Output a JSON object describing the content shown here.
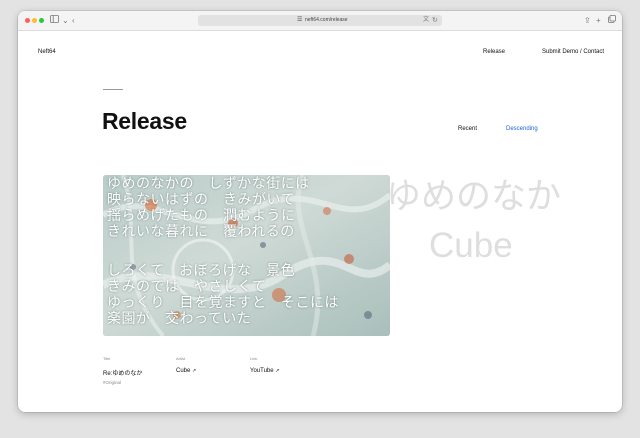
{
  "browser": {
    "url": "neft64.com/release",
    "icons": {
      "sidebar": "sidebar-icon",
      "back": "chevron-left-icon",
      "site": "site-settings-icon",
      "translate": "translate-icon",
      "reload": "reload-icon",
      "share": "share-icon",
      "new_tab": "plus-icon",
      "tabs": "tab-overview-icon"
    }
  },
  "site": {
    "logo": "Neft64",
    "nav": {
      "release": "Release",
      "submit": "Submit Demo / Contact"
    }
  },
  "page": {
    "title": "Release",
    "sort": {
      "recent": "Recent",
      "descending": "Descending",
      "active_color": "#1e63d6"
    }
  },
  "release": {
    "background_text": [
      "ゆめのなか",
      "Cube"
    ],
    "artwork_lines": [
      "ゆめのなかの　しずかな街には",
      "映らないはずの　きみがいて",
      "揺らめげたもの　潤むように",
      "きれいな暮れに　覆われるの",
      "",
      "しろくて　おぼろげな　景色",
      "きみのでは　やさしくて",
      "ゆっくり　目を覚ますと　そこには",
      "楽園が　交わっていた"
    ],
    "fields": {
      "title_label": "Title",
      "title_value": "Re:ゆめのなか",
      "artist_label": "Artist",
      "artist_value": "Cube",
      "link_label": "Link",
      "link_value": "YouTube",
      "external_arrow": "↗"
    },
    "tag": "#Original"
  }
}
